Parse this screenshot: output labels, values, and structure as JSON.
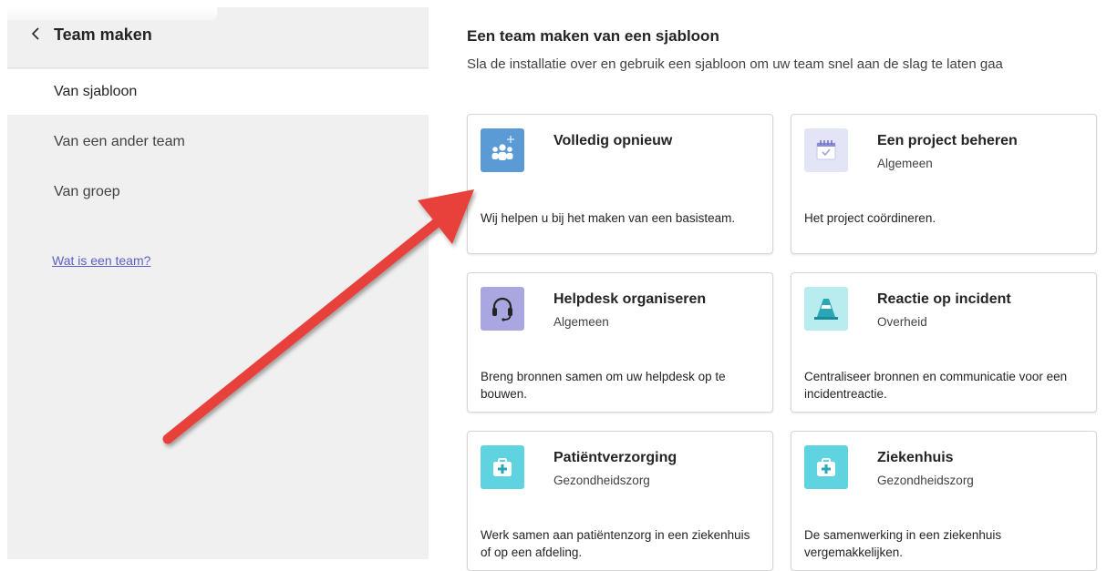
{
  "sidebar": {
    "header_title": "Team maken",
    "items": [
      {
        "label": "Van sjabloon",
        "selected": true
      },
      {
        "label": "Van een ander team",
        "selected": false
      },
      {
        "label": "Van groep",
        "selected": false
      }
    ],
    "help_link": "Wat is een team?"
  },
  "main": {
    "title": "Een team maken van een sjabloon",
    "subtitle": "Sla de installatie over en gebruik een sjabloon om uw team snel aan de slag te laten gaa"
  },
  "templates": [
    {
      "title": "Volledig opnieuw",
      "category": "",
      "description": "Wij helpen u bij het maken van een basisteam.",
      "icon": "people-add-icon",
      "tile_color": "#5b9bd5"
    },
    {
      "title": "Een project beheren",
      "category": "Algemeen",
      "description": "Het project coördineren.",
      "icon": "calendar-check-icon",
      "tile_color": "#e3e4f6"
    },
    {
      "title": "Helpdesk organiseren",
      "category": "Algemeen",
      "description": "Breng bronnen samen om uw helpdesk op te bouwen.",
      "icon": "headset-icon",
      "tile_color": "#aaa6e0"
    },
    {
      "title": "Reactie op incident",
      "category": "Overheid",
      "description": "Centraliseer bronnen en communicatie voor een incidentreactie.",
      "icon": "traffic-cone-icon",
      "tile_color": "#b8ecef"
    },
    {
      "title": "Patiëntverzorging",
      "category": "Gezondheidszorg",
      "description": "Werk samen aan patiëntenzorg in een ziekenhuis of op een afdeling.",
      "icon": "medical-kit-icon",
      "tile_color": "#5fd3e0"
    },
    {
      "title": "Ziekenhuis",
      "category": "Gezondheidszorg",
      "description": "De samenwerking in een ziekenhuis vergemakkelijken.",
      "icon": "medical-kit-icon",
      "tile_color": "#5fd3e0"
    }
  ],
  "colors": {
    "accent": "#5b5fc7",
    "annotation_arrow": "#e8413a"
  }
}
